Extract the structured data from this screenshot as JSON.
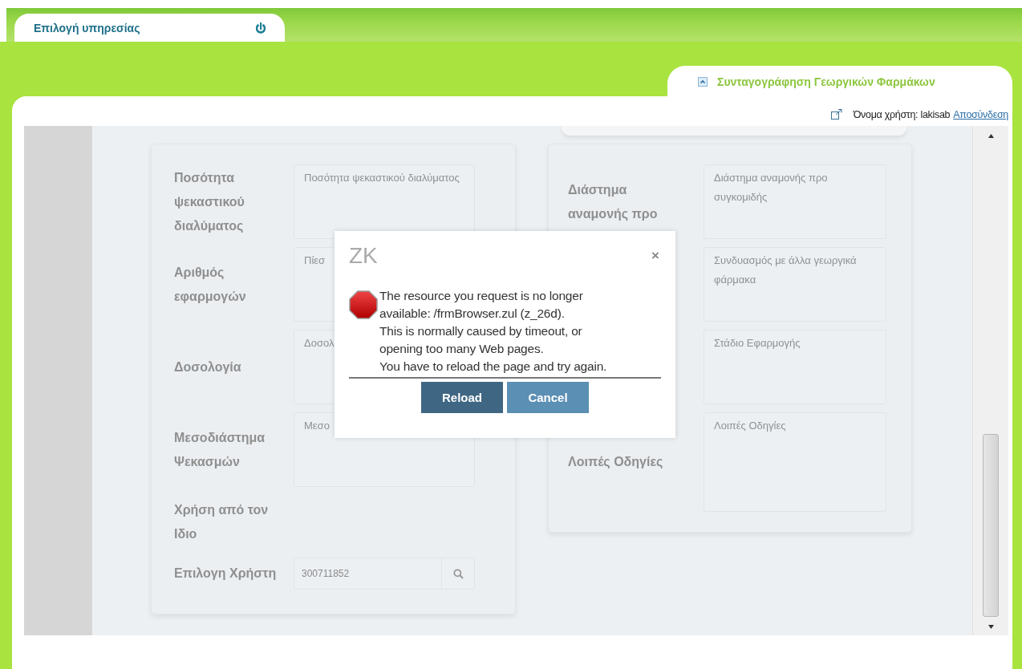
{
  "service_tab": {
    "label": "Επιλογή υπηρεσίας"
  },
  "app_title": "Συνταγογράφηση Γεωργικών Φαρμάκων",
  "user": {
    "label": "Όνομα χρήστη: lakisab",
    "logout": "Αποσύνδεση"
  },
  "left_form": {
    "rows": [
      {
        "kind": "textarea",
        "label": "Ποσότητα ψεκαστικού διαλύματος",
        "placeholder": "Ποσότητα ψεκαστικού διαλύματος"
      },
      {
        "kind": "textarea",
        "label": "Αριθμός εφαρμογών",
        "placeholder": "Πίεσ"
      },
      {
        "kind": "textarea",
        "label": "Δοσολογία",
        "placeholder": "Δοσολ"
      },
      {
        "kind": "textarea",
        "label": "Μεσοδιάστημα Ψεκασμών",
        "placeholder": "Μεσο"
      },
      {
        "kind": "text",
        "label": "Χρήση από τον Ιδιο"
      },
      {
        "kind": "lookup",
        "label": "Επιλογη Χρήστη",
        "value": "300711852"
      }
    ]
  },
  "right_form": {
    "rows": [
      {
        "kind": "textarea",
        "label": "Διάστημα αναμονής προ",
        "placeholder": "Διάστημα αναμονής προ συγκομιδής"
      },
      {
        "kind": "textarea",
        "placeholder": "Συνδυασμός με άλλα γεωργικά φάρμακα"
      },
      {
        "kind": "textarea",
        "placeholder": "Στάδιο Εφαρμογής"
      },
      {
        "kind": "tall",
        "label": "Λοιπές Οδηγίες",
        "placeholder": "Λοιπές Οδηγίες"
      }
    ]
  },
  "dialog": {
    "title": "ZK",
    "close": "×",
    "message": [
      "The resource you request is no longer",
      "available: /frmBrowser.zul (z_26d).",
      "This is normally caused by timeout, or",
      "opening too many Web pages.",
      "You have to reload the page and try again."
    ],
    "buttons": [
      {
        "label": "Reload",
        "kind": "primary"
      },
      {
        "label": "Cancel",
        "kind": "secondary"
      }
    ]
  }
}
